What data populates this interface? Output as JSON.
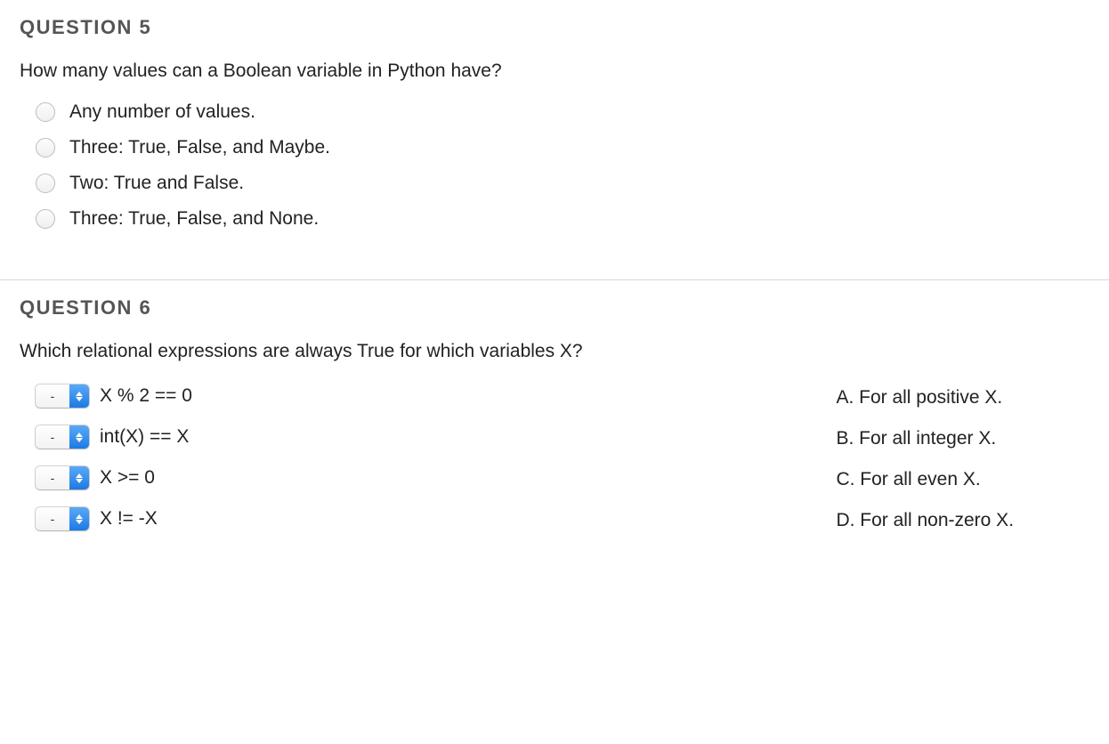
{
  "questions": [
    {
      "title": "QUESTION 5",
      "prompt": "How many values can a Boolean variable in Python have?",
      "options": [
        "Any number of values.",
        "Three: True, False, and Maybe.",
        "Two: True and False.",
        "Three: True, False, and None."
      ]
    },
    {
      "title": "QUESTION 6",
      "prompt": "Which relational expressions are always True for which variables X?",
      "match_items": [
        {
          "selected": "-",
          "expr": "X % 2 == 0"
        },
        {
          "selected": "-",
          "expr": "int(X) == X"
        },
        {
          "selected": "-",
          "expr": "X >= 0"
        },
        {
          "selected": "-",
          "expr": "X != -X"
        }
      ],
      "match_answers": [
        "A. For all positive X.",
        "B. For all integer X.",
        "C. For all even X.",
        "D. For all non-zero X."
      ]
    }
  ]
}
